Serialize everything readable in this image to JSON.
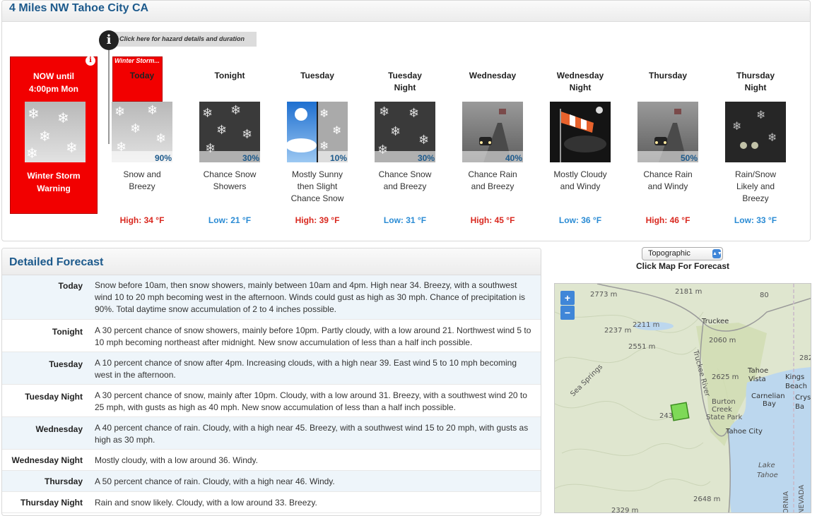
{
  "location": {
    "title": "4 Miles NW Tahoe City CA"
  },
  "hazard": {
    "link_text": "Click here for hazard details and duration",
    "now_title_line1": "NOW until",
    "now_title_line2": "4:00pm Mon",
    "now_warning_line1": "Winter Storm",
    "now_warning_line2": "Warning",
    "today_banner": "Winter Storm..."
  },
  "periods": [
    {
      "name1": "Today",
      "name2": "",
      "pop": "90%",
      "desc1": "Snow and",
      "desc2": "Breezy",
      "desc3": "",
      "temp": "High: 34 °F",
      "kind": "high",
      "image": "snow-breezy"
    },
    {
      "name1": "Tonight",
      "name2": "",
      "pop": "30%",
      "desc1": "Chance Snow",
      "desc2": "Showers",
      "desc3": "",
      "temp": "Low: 21 °F",
      "kind": "low",
      "image": "snow-night"
    },
    {
      "name1": "Tuesday",
      "name2": "",
      "pop": "10%",
      "desc1": "Mostly Sunny",
      "desc2": "then Slight",
      "desc3": "Chance Snow",
      "temp": "High: 39 °F",
      "kind": "high",
      "image": "sunny-then-snow"
    },
    {
      "name1": "Tuesday",
      "name2": "Night",
      "pop": "30%",
      "desc1": "Chance Snow",
      "desc2": "and Breezy",
      "desc3": "",
      "temp": "Low: 31 °F",
      "kind": "low",
      "image": "snow-night"
    },
    {
      "name1": "Wednesday",
      "name2": "",
      "pop": "40%",
      "desc1": "Chance Rain",
      "desc2": "and Breezy",
      "desc3": "",
      "temp": "High: 45 °F",
      "kind": "high",
      "image": "rain-road"
    },
    {
      "name1": "Wednesday",
      "name2": "Night",
      "pop": "",
      "desc1": "Mostly Cloudy",
      "desc2": "and Windy",
      "desc3": "",
      "temp": "Low: 36 °F",
      "kind": "low",
      "image": "windsock-night"
    },
    {
      "name1": "Thursday",
      "name2": "",
      "pop": "50%",
      "desc1": "Chance Rain",
      "desc2": "and Windy",
      "desc3": "",
      "temp": "High: 46 °F",
      "kind": "high",
      "image": "rain-road"
    },
    {
      "name1": "Thursday",
      "name2": "Night",
      "pop": "",
      "desc1": "Rain/Snow",
      "desc2": "Likely and",
      "desc3": "Breezy",
      "temp": "Low: 33 °F",
      "kind": "low",
      "image": "rain-snow-night"
    }
  ],
  "detailed": {
    "title": "Detailed Forecast",
    "rows": [
      {
        "label": "Today",
        "text": "Snow before 10am, then snow showers, mainly between 10am and 4pm. High near 34. Breezy, with a southwest wind 10 to 20 mph becoming west in the afternoon. Winds could gust as high as 30 mph. Chance of precipitation is 90%. Total daytime snow accumulation of 2 to 4 inches possible."
      },
      {
        "label": "Tonight",
        "text": "A 30 percent chance of snow showers, mainly before 10pm. Partly cloudy, with a low around 21. Northwest wind 5 to 10 mph becoming northeast after midnight. New snow accumulation of less than a half inch possible."
      },
      {
        "label": "Tuesday",
        "text": "A 10 percent chance of snow after 4pm. Increasing clouds, with a high near 39. East wind 5 to 10 mph becoming west in the afternoon."
      },
      {
        "label": "Tuesday Night",
        "text": "A 30 percent chance of snow, mainly after 10pm. Cloudy, with a low around 31. Breezy, with a southwest wind 20 to 25 mph, with gusts as high as 40 mph. New snow accumulation of less than a half inch possible."
      },
      {
        "label": "Wednesday",
        "text": "A 40 percent chance of rain. Cloudy, with a high near 45. Breezy, with a southwest wind 15 to 20 mph, with gusts as high as 30 mph."
      },
      {
        "label": "Wednesday Night",
        "text": "Mostly cloudy, with a low around 36. Windy."
      },
      {
        "label": "Thursday",
        "text": "A 50 percent chance of rain. Cloudy, with a high near 46. Windy."
      },
      {
        "label": "Thursday Night",
        "text": "Rain and snow likely. Cloudy, with a low around 33. Breezy."
      }
    ]
  },
  "map": {
    "layer_select": "Topographic",
    "caption": "Click Map For Forecast",
    "zoom_in": "+",
    "zoom_out": "−",
    "labels": [
      "2773 m",
      "2181 m",
      "80",
      "2237 m",
      "2211 m",
      "Truckee",
      "2551 m",
      "2060 m",
      "Truckee River",
      "2625 m",
      "Tahoe",
      "Vista",
      "Kings",
      "Beach",
      "Carnelian",
      "Bay",
      "Crys",
      "Ba",
      "Burton",
      "Creek",
      "State Park",
      "Sea Springs",
      "243",
      "Tahoe City",
      "Lake",
      "Tahoe",
      "ORNIA",
      "NEVADA",
      "2648 m",
      "2329 m",
      "282"
    ],
    "colors": {
      "terrain": "#dfe6cf",
      "lake": "#bcd7ee",
      "forecast_square": "#7ed957"
    }
  }
}
